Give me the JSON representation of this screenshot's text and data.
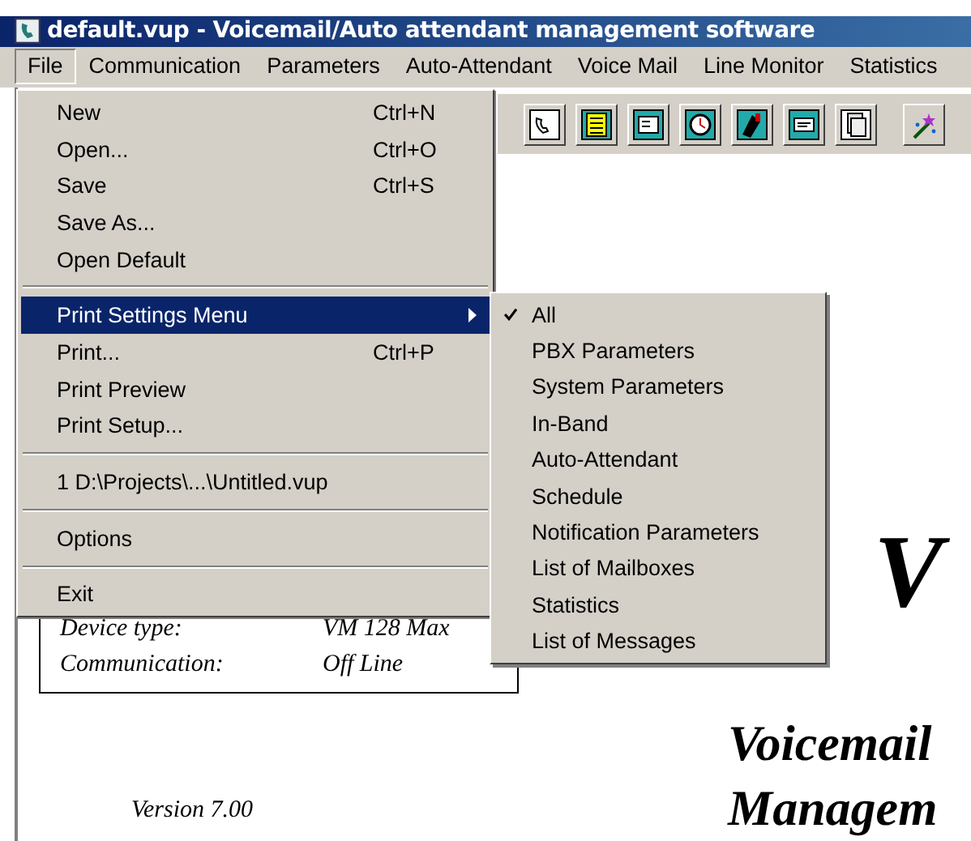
{
  "window": {
    "title": "default.vup - Voicemail/Auto attendant management software"
  },
  "menubar": [
    {
      "label": "File",
      "selected": true
    },
    {
      "label": "Communication",
      "selected": false
    },
    {
      "label": "Parameters",
      "selected": false
    },
    {
      "label": "Auto-Attendant",
      "selected": false
    },
    {
      "label": "Voice Mail",
      "selected": false
    },
    {
      "label": "Line Monitor",
      "selected": false
    },
    {
      "label": "Statistics",
      "selected": false
    }
  ],
  "file_menu": [
    {
      "kind": "item",
      "label": "New",
      "shortcut": "Ctrl+N",
      "selected": false
    },
    {
      "kind": "item",
      "label": "Open...",
      "shortcut": "Ctrl+O",
      "selected": false
    },
    {
      "kind": "item",
      "label": "Save",
      "shortcut": "Ctrl+S",
      "selected": false
    },
    {
      "kind": "item",
      "label": "Save As...",
      "selected": false
    },
    {
      "kind": "item",
      "label": "Open Default",
      "selected": false
    },
    {
      "kind": "separator"
    },
    {
      "kind": "submenu",
      "label": "Print Settings Menu",
      "selected": true
    },
    {
      "kind": "item",
      "label": "Print...",
      "shortcut": "Ctrl+P",
      "selected": false
    },
    {
      "kind": "item",
      "label": "Print Preview",
      "selected": false
    },
    {
      "kind": "item",
      "label": "Print Setup...",
      "selected": false
    },
    {
      "kind": "separator"
    },
    {
      "kind": "item",
      "label": "1 D:\\Projects\\...\\Untitled.vup",
      "selected": false
    },
    {
      "kind": "separator"
    },
    {
      "kind": "item",
      "label": "Options",
      "selected": false
    },
    {
      "kind": "separator"
    },
    {
      "kind": "item",
      "label": "Exit",
      "selected": false
    }
  ],
  "print_settings_submenu": [
    {
      "label": "All",
      "checked": true
    },
    {
      "label": "PBX Parameters",
      "checked": false
    },
    {
      "label": "System Parameters",
      "checked": false
    },
    {
      "label": "In-Band",
      "checked": false
    },
    {
      "label": "Auto-Attendant",
      "checked": false
    },
    {
      "label": "Schedule",
      "checked": false
    },
    {
      "label": "Notification Parameters",
      "checked": false
    },
    {
      "label": "List of Mailboxes",
      "checked": false
    },
    {
      "label": "Statistics",
      "checked": false
    },
    {
      "label": "List of Messages",
      "checked": false
    }
  ],
  "info_card": [
    {
      "label": "Device type:",
      "value": "VM 128 Max"
    },
    {
      "label": "Communication:",
      "value": "Off Line"
    }
  ],
  "version": "Version 7.00",
  "big_letter": "V",
  "product_title": [
    "Voicemail",
    "Managem"
  ]
}
